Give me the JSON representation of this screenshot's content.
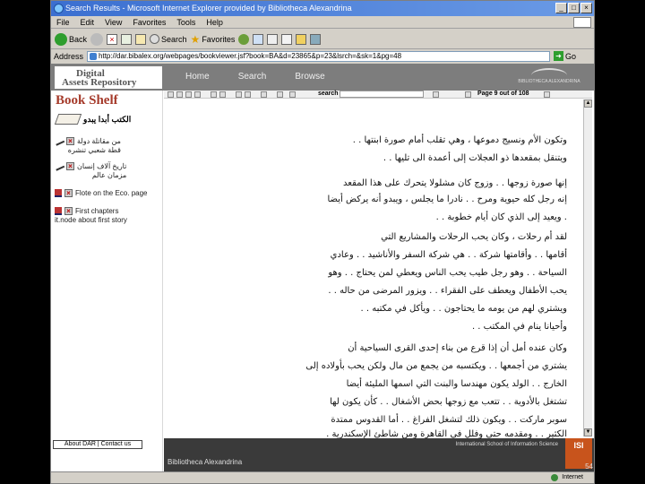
{
  "window": {
    "title": "Search Results - Microsoft Internet Explorer provided by Bibliotheca Alexandrina"
  },
  "menu": [
    "File",
    "Edit",
    "View",
    "Favorites",
    "Tools",
    "Help"
  ],
  "toolbar": {
    "back": "Back",
    "search": "Search",
    "favorites": "Favorites"
  },
  "address": {
    "label": "Address",
    "url": "http://dar.bibalex.org/webpages/bookviewer.jsf?book=BA&d=23865&p=23&lsrch=&sk=1&pg=48",
    "go": "Go"
  },
  "header": {
    "logo_line1": "Digital",
    "logo_line2": "Assets Repository",
    "nav": [
      "Home",
      "Search",
      "Browse"
    ],
    "bib_caption": "BIBLIOTHECA ALEXANDRINA"
  },
  "sidebar": {
    "title": "Book Shelf",
    "arabic_label": "الكتب أبدا يبدو",
    "items": [
      {
        "line1": "من مقاتلة دولة",
        "line2": "قطة شعبي تنشره"
      },
      {
        "line1": "تاريخ آلاف إنسان",
        "line2": "مزمان عالم"
      },
      {
        "line1": "Flote on the Eco. page",
        "line2": ""
      },
      {
        "line1": "First chapters",
        "line2": "it.node about first story"
      }
    ]
  },
  "viewer": {
    "search_label": "search",
    "page_info": "Page 9 out of 108"
  },
  "page_lines": [
    "وتكون الأم ونسيج دموعها ، وهي تقلب أمام صورة ابنتها . .",
    "ويتنقل بمقعدها ذو العجلات إلى أعمدة الى تليها . .",
    "إنها صورة زوجها . . وزوج كان مشلولا يتحرك على هذا المقعد",
    "إنه رجل كله حيوية ومرح . . نادرا ما يجلس ، ويبدو أنه يركض أيضا",
    ". ويعيد إلى الذي كان أيام خطوبة . .",
    "لقد أم رحلات ، وكان يحب الرحلات والمشاريع التي",
    "أقامها . . وأقامتها شركة . . هي شركة السفر والأناشيد . . وعادي",
    "السياحة . . وهو رجل طيب يحب الناس ويعطي لمن يحتاج . . وهو",
    "يحب الأطفال ويعطف على الفقراء . . ويزور المرضى من حاله . .",
    "ويشتري لهم من يومه ما يحتاجون . . ويأكل في مكتبه . .",
    "وأحيانا ينام في المكتب . .",
    "وكان عنده أمل أن إذا قرع من بناء إحدى القرى السياحية أن",
    "يشتري من أجمعها . . ويكتسبه من يجمع من مال ولكن يحب بأولاده إلى",
    "الخارج . . الولد يكون مهندسا والبنت التي اسمها المليئة أيضا",
    "تشتغل بالأدوية . . تتعب مع زوجها بحض الأشغال . . كأن يكون لها",
    "سوبر ماركت . . ويكون ذلك لتشغل الفراغ . . أما القدوس ممتدة",
    "الكثير . . ومقدمه حتى وفلل في القاهرة ومن شاطئ الإسكندرية ."
  ],
  "footer": {
    "links": "About DAR | Contact us",
    "bib": "Bibliotheca Alexandrina",
    "isi": "International School of Information Science",
    "isi_logo": "ISI"
  },
  "status": {
    "zone": "Internet"
  },
  "slide_number": "54"
}
